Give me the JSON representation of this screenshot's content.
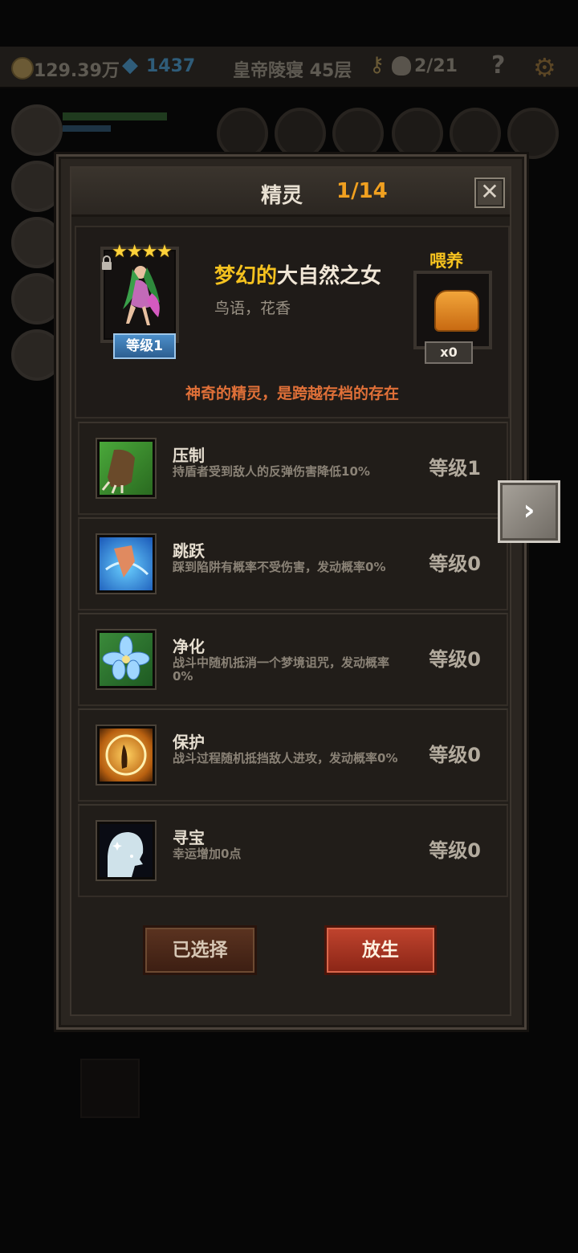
{
  "topbar": {
    "gold": "129.39万",
    "gems": "1437",
    "location": "皇帝陵寝 45层",
    "skull_count": "2/21",
    "help": "?"
  },
  "dialog": {
    "title": "精灵",
    "count": "1/14",
    "close_glyph": "✕",
    "sprite": {
      "stars": "★★★★",
      "level_badge": "等级1",
      "name_prefix": "梦幻的",
      "name_main": "大自然之女",
      "subtitle": "鸟语，花香",
      "feed_label": "喂养",
      "food_count": "x0",
      "description": "神奇的精灵，是跨越存档的存在"
    },
    "skills": [
      {
        "name": "压制",
        "desc": "持盾者受到敌人的反弹伤害降低10%",
        "level": "等级1",
        "icon": "claw-icon"
      },
      {
        "name": "跳跃",
        "desc": "踩到陷阱有概率不受伤害，发动概率0%",
        "level": "等级0",
        "icon": "leap-icon"
      },
      {
        "name": "净化",
        "desc": "战斗中随机抵消一个梦境诅咒，发动概率0%",
        "level": "等级0",
        "icon": "flower-icon"
      },
      {
        "name": "保护",
        "desc": "战斗过程随机抵挡敌人进攻，发动概率0%",
        "level": "等级0",
        "icon": "fairy-shield-icon"
      },
      {
        "name": "寻宝",
        "desc": "幸运增加0点",
        "level": "等级0",
        "icon": "treasure-silhouette-icon"
      }
    ],
    "next_glyph": "›",
    "buttons": {
      "selected": "已选择",
      "release": "放生"
    }
  },
  "colors": {
    "accent_gold": "#f5c21f",
    "count_orange": "#f0a020",
    "description_orange": "#e07038",
    "release_red": "#c0442e"
  }
}
